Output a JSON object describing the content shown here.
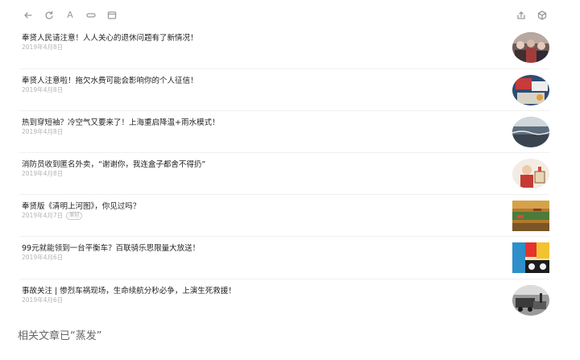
{
  "toolbar": {
    "left_icons": [
      "back-arrow-icon",
      "refresh-icon",
      "font-size-icon",
      "link-icon",
      "bookmark-icon"
    ],
    "font_label": "A",
    "right_icons": [
      "share-icon",
      "cube-icon"
    ]
  },
  "articles": [
    {
      "title": "奉贤人民请注意！人人关心的退休问题有了新情况！",
      "date": "2019年4月8日",
      "tag": ""
    },
    {
      "title": "奉贤人注意啦！拖欠水费可能会影响你的个人征信！",
      "date": "2019年4月8日",
      "tag": ""
    },
    {
      "title": "热到穿短袖？冷空气又要来了！上海重启降温+雨水模式！",
      "date": "2019年4月8日",
      "tag": ""
    },
    {
      "title": "消防员收到匿名外卖，“谢谢你，我连盒子都舍不得扔”",
      "date": "2019年4月8日",
      "tag": ""
    },
    {
      "title": "奉贤版《清明上河图》，你见过吗？",
      "date": "2019年4月7日",
      "tag": "原创"
    },
    {
      "title": "99元就能领到一台平衡车？百联骑乐思限量大放送！",
      "date": "2019年4月6日",
      "tag": ""
    },
    {
      "title": "事故关注 | 惨烈车祸现场，生命续航分秒必争，上演生死救援！",
      "date": "2019年4月6日",
      "tag": ""
    }
  ],
  "footer": {
    "text": "相关文章已“蒸发”"
  },
  "colors": {
    "title": "#1f1f1f",
    "date": "#b3b3b3",
    "icon": "#9a9a9a",
    "divider": "#f0f0f0"
  }
}
